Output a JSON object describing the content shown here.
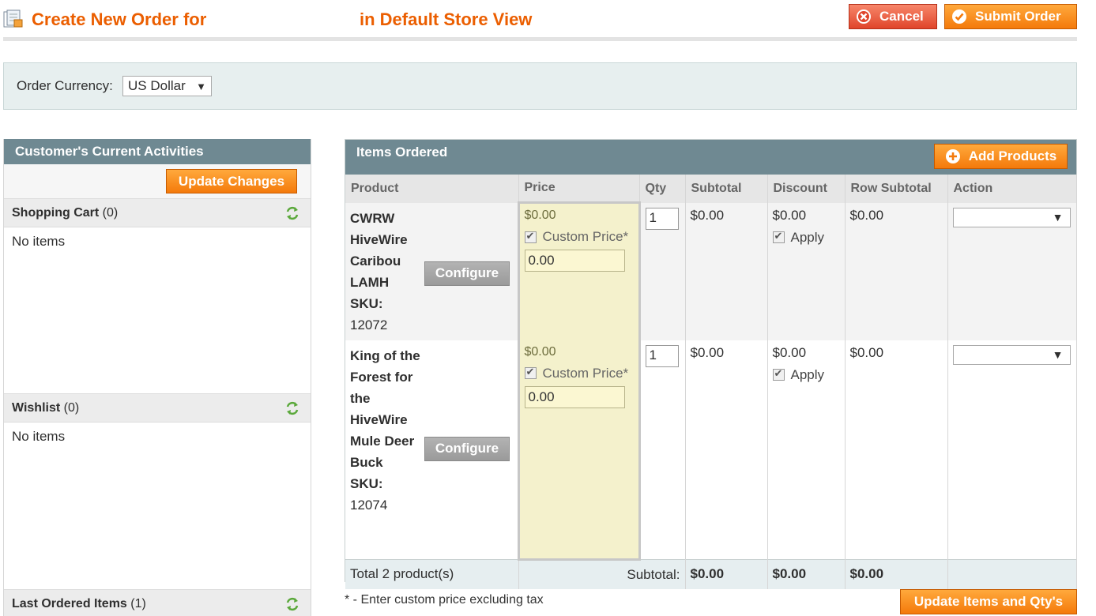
{
  "header": {
    "title_left": "Create New Order for",
    "title_right": "in Default Store View",
    "cancel_label": "Cancel",
    "submit_label": "Submit Order"
  },
  "currency": {
    "label": "Order Currency:",
    "selected": "US Dollar"
  },
  "sidebar": {
    "title": "Customer's Current Activities",
    "update_label": "Update Changes",
    "shopping_cart": {
      "title": "Shopping Cart",
      "count": "(0)",
      "empty": "No items"
    },
    "wishlist": {
      "title": "Wishlist",
      "count": "(0)",
      "empty": "No items"
    },
    "last_ordered": {
      "title": "Last Ordered Items",
      "count": "(1)"
    }
  },
  "items": {
    "title": "Items Ordered",
    "add_label": "Add Products",
    "columns": [
      "Product",
      "Price",
      "Qty",
      "Subtotal",
      "Discount",
      "Row Subtotal",
      "Action"
    ],
    "configure_label": "Configure",
    "custom_price_label": "Custom Price*",
    "apply_label": "Apply",
    "rows": [
      {
        "name": "CWRW HiveWire Caribou LAMH",
        "sku_label": "SKU:",
        "sku": "12072",
        "price": "$0.00",
        "custom_price": "0.00",
        "qty": "1",
        "subtotal": "$0.00",
        "discount": "$0.00",
        "row_subtotal": "$0.00"
      },
      {
        "name": "King of the Forest for the HiveWire Mule Deer Buck",
        "sku_label": "SKU:",
        "sku": "12074",
        "price": "$0.00",
        "custom_price": "0.00",
        "qty": "1",
        "subtotal": "$0.00",
        "discount": "$0.00",
        "row_subtotal": "$0.00"
      }
    ],
    "totals": {
      "label": "Total 2 product(s)",
      "subtotal_label": "Subtotal:",
      "subtotal": "$0.00",
      "discount": "$0.00",
      "row_subtotal": "$0.00"
    },
    "note": "* - Enter custom price excluding tax",
    "update_items_label": "Update Items and Qty's"
  },
  "colors": {
    "accent_orange": "#f47a0b",
    "title_orange": "#eb5e00",
    "header_slate": "#6f8992",
    "price_highlight": "#f4f1cc"
  }
}
